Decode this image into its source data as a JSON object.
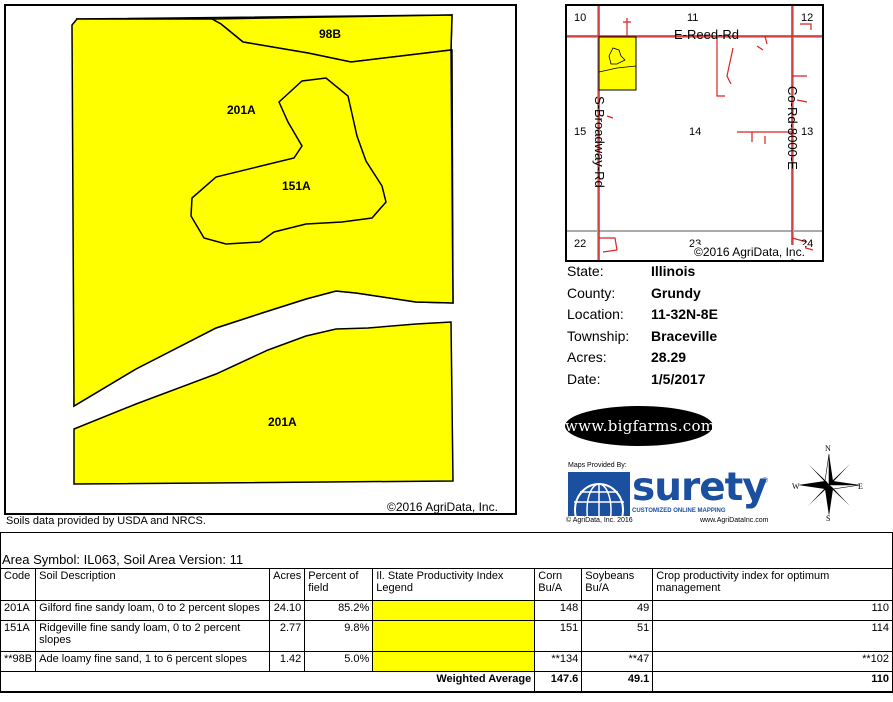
{
  "soil_map": {
    "labels": {
      "p98b": "98B",
      "p201a_top": "201A",
      "p151a": "151A",
      "p201a_bottom": "201A"
    },
    "copyright": "©2016 AgriData, Inc.",
    "fill_color": "#ffff00"
  },
  "source_note": "Soils data provided by USDA and NRCS.",
  "locator_map": {
    "sections": {
      "s10": "10",
      "s11": "11",
      "s12": "12",
      "s15": "15",
      "s14": "14",
      "s13": "13",
      "s22": "22",
      "s23": "23",
      "s24": "24"
    },
    "roads": {
      "reed": "E-Reed-Rd",
      "broadway": "S-Broadway-Rd",
      "co_rd": "Co-Rd-8000-E"
    },
    "copyright": "©2016 AgriData, Inc.",
    "road_color": "#dd2222"
  },
  "info": {
    "state_label": "State:",
    "state": "Illinois",
    "county_label": "County:",
    "county": "Grundy",
    "location_label": "Location:",
    "location": "11-32N-8E",
    "township_label": "Township:",
    "township": "Braceville",
    "acres_label": "Acres:",
    "acres": "28.29",
    "date_label": "Date:",
    "date": "1/5/2017"
  },
  "bigfarms_logo": "www.bigfarms.com",
  "surety_logo": {
    "maps_provided": "Maps Provided By:",
    "word": "surety",
    "reg": "®",
    "tagline": "CUSTOMIZED ONLINE MAPPING",
    "copyright": "© AgriData, Inc. 2016",
    "url": "www.AgriDataInc.com"
  },
  "compass": {
    "n": "N",
    "s": "S",
    "e": "E",
    "w": "W"
  },
  "table": {
    "title": "Area Symbol: IL063, Soil Area Version: 11",
    "headers": {
      "code": "Code",
      "desc": "Soil Description",
      "acres": "Acres",
      "pct": "Percent of field",
      "legend": "Il. State Productivity Index Legend",
      "corn": "Corn Bu/A",
      "soy": "Soybeans Bu/A",
      "cpi": "Crop productivity index for optimum management"
    },
    "rows": [
      {
        "code": "201A",
        "desc": "Gilford fine sandy loam, 0 to 2 percent slopes",
        "acres": "24.10",
        "pct": "85.2%",
        "corn": "148",
        "soy": "49",
        "cpi": "110"
      },
      {
        "code": "151A",
        "desc": "Ridgeville fine sandy loam, 0 to 2 percent slopes",
        "acres": "2.77",
        "pct": "9.8%",
        "corn": "151",
        "soy": "51",
        "cpi": "114"
      },
      {
        "code": "**98B",
        "desc": "Ade loamy fine sand, 1 to 6 percent slopes",
        "acres": "1.42",
        "pct": "5.0%",
        "corn": "**134",
        "soy": "**47",
        "cpi": "**102"
      }
    ],
    "legend_color": "#ffff00",
    "weighted": {
      "label": "Weighted Average",
      "corn": "147.6",
      "soy": "49.1",
      "cpi": "110"
    }
  }
}
